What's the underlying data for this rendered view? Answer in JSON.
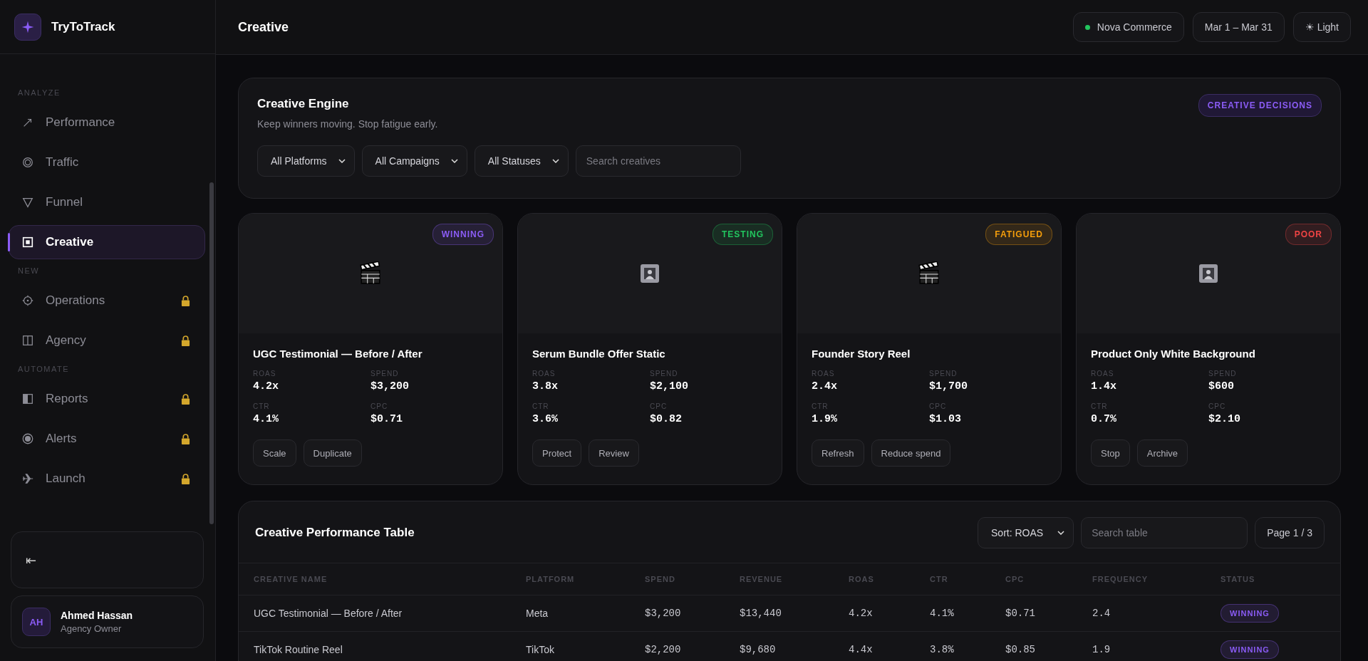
{
  "brand": {
    "name": "TryToTrack"
  },
  "sidebar": {
    "sections": [
      {
        "title": "ANALYZE",
        "items": [
          {
            "label": "Performance",
            "selected": false,
            "locked": false
          },
          {
            "label": "Traffic",
            "selected": false,
            "locked": false
          },
          {
            "label": "Funnel",
            "selected": false,
            "locked": false
          },
          {
            "label": "Creative",
            "selected": true,
            "locked": false
          }
        ]
      },
      {
        "title": "NEW",
        "items": [
          {
            "label": "Operations",
            "selected": false,
            "locked": true
          },
          {
            "label": "Agency",
            "selected": false,
            "locked": true
          }
        ]
      },
      {
        "title": "AUTOMATE",
        "items": [
          {
            "label": "Reports",
            "selected": false,
            "locked": true
          },
          {
            "label": "Alerts",
            "selected": false,
            "locked": true
          },
          {
            "label": "Launch",
            "selected": false,
            "locked": true
          }
        ]
      }
    ],
    "collapse": "⇤",
    "user": {
      "initials": "AH",
      "name": "Ahmed Hassan",
      "role": "Agency Owner"
    }
  },
  "header": {
    "title": "Creative",
    "account": {
      "name": "Nova Commerce",
      "color": "#22c55e"
    },
    "date_range": "Mar 1 – Mar 31",
    "theme": "☀ Light"
  },
  "engine": {
    "title": "Creative Engine",
    "subtitle": "Keep winners moving. Stop fatigue early.",
    "tag": "CREATIVE DECISIONS",
    "filters": [
      "All Platforms",
      "All Campaigns",
      "All Statuses"
    ],
    "search": {
      "placeholder": "Search creatives"
    }
  },
  "creatives": [
    {
      "kind": "video",
      "status": "WINNING",
      "color": "#8b5cf6",
      "title": "UGC Testimonial — Before / After",
      "metrics": [
        {
          "label": "ROAS",
          "value": "4.2x"
        },
        {
          "label": "SPEND",
          "value": "$3,200"
        },
        {
          "label": "CTR",
          "value": "4.1%"
        },
        {
          "label": "CPC",
          "value": "$0.71"
        }
      ],
      "actions": [
        "Scale",
        "Duplicate"
      ]
    },
    {
      "kind": "image",
      "status": "TESTING",
      "color": "#22c55e",
      "title": "Serum Bundle Offer Static",
      "metrics": [
        {
          "label": "ROAS",
          "value": "3.8x"
        },
        {
          "label": "SPEND",
          "value": "$2,100"
        },
        {
          "label": "CTR",
          "value": "3.6%"
        },
        {
          "label": "CPC",
          "value": "$0.82"
        }
      ],
      "actions": [
        "Protect",
        "Review"
      ]
    },
    {
      "kind": "video",
      "status": "FATIGUED",
      "color": "#f59e0b",
      "title": "Founder Story Reel",
      "metrics": [
        {
          "label": "ROAS",
          "value": "2.4x"
        },
        {
          "label": "SPEND",
          "value": "$1,700"
        },
        {
          "label": "CTR",
          "value": "1.9%"
        },
        {
          "label": "CPC",
          "value": "$1.03"
        }
      ],
      "actions": [
        "Refresh",
        "Reduce spend"
      ]
    },
    {
      "kind": "image",
      "status": "POOR",
      "color": "#ef4444",
      "title": "Product Only White Background",
      "metrics": [
        {
          "label": "ROAS",
          "value": "1.4x"
        },
        {
          "label": "SPEND",
          "value": "$600"
        },
        {
          "label": "CTR",
          "value": "0.7%"
        },
        {
          "label": "CPC",
          "value": "$2.10"
        }
      ],
      "actions": [
        "Stop",
        "Archive"
      ]
    }
  ],
  "table": {
    "title": "Creative Performance Table",
    "sort": "Sort: ROAS",
    "search": {
      "placeholder": "Search table"
    },
    "page": "Page 1 / 3",
    "columns": [
      "CREATIVE NAME",
      "PLATFORM",
      "SPEND",
      "REVENUE",
      "ROAS",
      "CTR",
      "CPC",
      "FREQUENCY",
      "STATUS"
    ],
    "rows": [
      {
        "cells": [
          "UGC Testimonial — Before / After",
          "Meta",
          "$3,200",
          "$13,440",
          "4.2x",
          "4.1%",
          "$0.71",
          "2.4"
        ],
        "status": "WINNING",
        "color": "#8b5cf6"
      },
      {
        "cells": [
          "TikTok Routine Reel",
          "TikTok",
          "$2,200",
          "$9,680",
          "4.4x",
          "3.8%",
          "$0.85",
          "1.9"
        ],
        "status": "WINNING",
        "color": "#8b5cf6"
      }
    ]
  }
}
